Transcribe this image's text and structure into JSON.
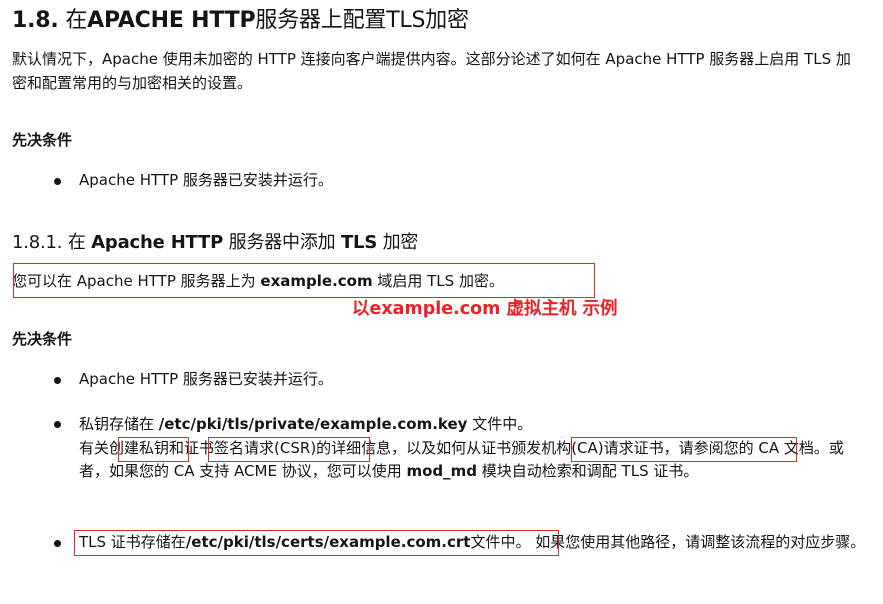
{
  "section": {
    "title_num": "1.8.",
    "title_pre": " 在",
    "title_bold": "APACHE HTTP",
    "title_post": "服务器上配置TLS加密",
    "intro": "默认情况下，Apache 使用未加密的 HTTP 连接向客户端提供内容。这部分论述了如何在 Apache HTTP 服务器上启用 TLS 加密和配置常用的与加密相关的设置。",
    "prereq_heading": "先决条件",
    "prereq_items": [
      "Apache HTTP 服务器已安装并运行。"
    ]
  },
  "subsection": {
    "title_num": "1.8.1.",
    "title_pre": " 在 ",
    "title_bold1": "Apache HTTP",
    "title_mid": " 服务器中添加 ",
    "title_bold2": "TLS",
    "title_post": " 加密",
    "intro_pre": "您可以在 Apache HTTP 服务器上为 ",
    "intro_bold": "example.com",
    "intro_post": " 域启用 TLS 加密。",
    "annotation": "以example.com 虚拟主机 示例",
    "prereq_heading": "先决条件",
    "item1": "Apache HTTP 服务器已安装并运行。",
    "item2_pre": "私钥存储在 ",
    "item2_path": "/etc/pki/tls/private/example.com.key",
    "item2_post": " 文件中。",
    "item2_line2_a": "有关",
    "item2_link1": "创建私钥",
    "item2_line2_b": "和",
    "item2_link2": "证书签名请求(CSR)",
    "item2_line2_c": "的详细信息，以及如何从",
    "item2_link3": "证书颁发机构(CA)请求证书",
    "item2_line2_d": "，请参阅您的 CA 文档。或者，如果您的 CA 支持 ACME 协议，您可以使用 ",
    "item2_mod": "mod_md",
    "item2_line2_e": " 模块自动检索和调配 TLS 证书。",
    "item3_pre": "TLS 证书存储在",
    "item3_path": "/etc/pki/tls/certs/example.com.crt",
    "item3_post": "文件中。",
    "item3_rest": " 如果您使用其他路径，请调整该流程的对应步骤。"
  }
}
